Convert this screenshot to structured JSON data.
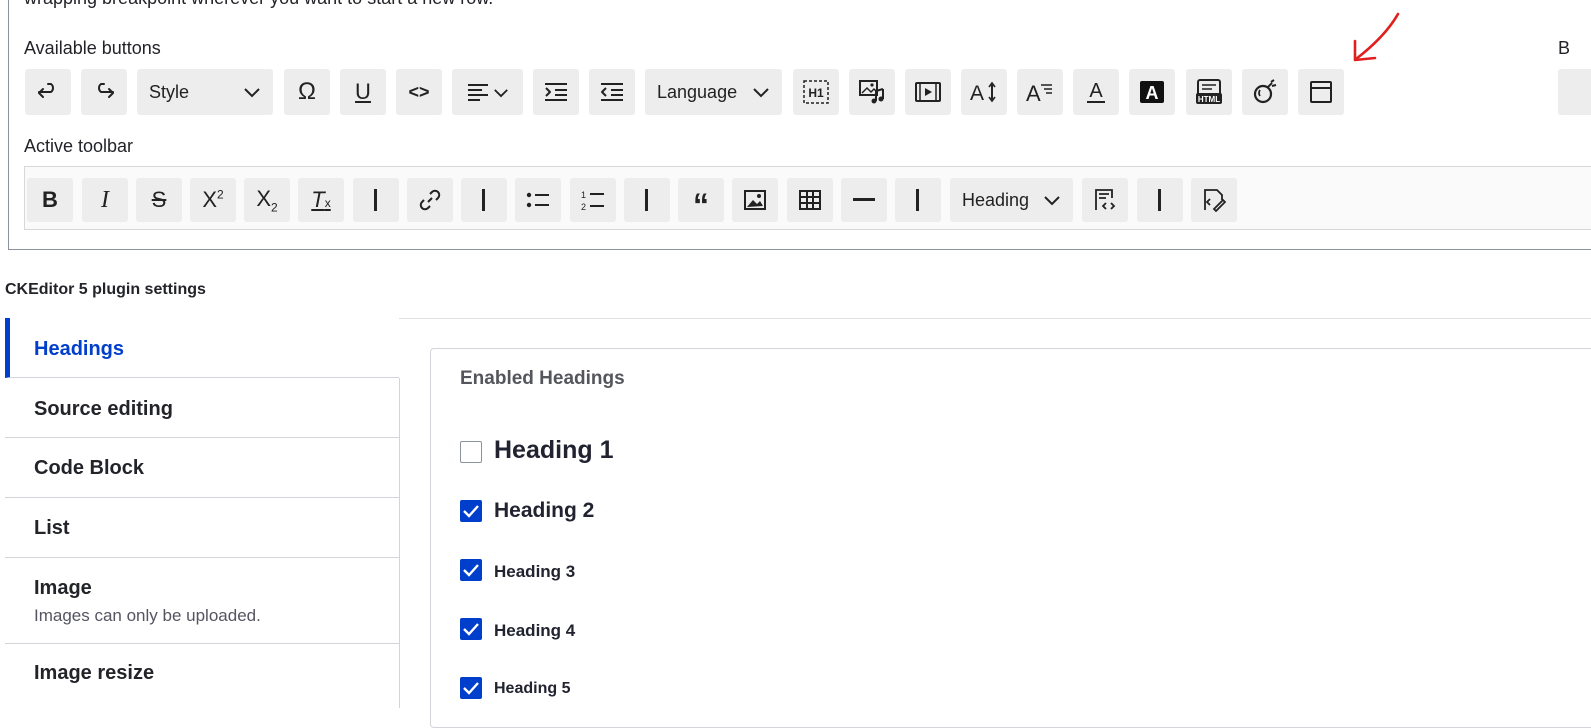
{
  "intro_text": "wrapping breakpoint wherever you want to start a new row.",
  "available": {
    "label": "Available buttons",
    "right_letter": "B",
    "buttons": [
      {
        "name": "undo-icon"
      },
      {
        "name": "redo-icon"
      },
      {
        "name": "style-dropdown",
        "label": "Style"
      },
      {
        "name": "special-characters-icon"
      },
      {
        "name": "underline-icon"
      },
      {
        "name": "code-icon"
      },
      {
        "name": "alignment-dropdown"
      },
      {
        "name": "indent-icon"
      },
      {
        "name": "outdent-icon"
      },
      {
        "name": "language-dropdown",
        "label": "Language"
      },
      {
        "name": "heading-h1-icon"
      },
      {
        "name": "media-library-icon"
      },
      {
        "name": "media-embed-icon"
      },
      {
        "name": "font-size-icon"
      },
      {
        "name": "font-family-icon"
      },
      {
        "name": "font-color-icon"
      },
      {
        "name": "font-background-color-icon"
      },
      {
        "name": "html-embed-icon"
      },
      {
        "name": "bomb-icon"
      },
      {
        "name": "layout-icon"
      }
    ]
  },
  "active": {
    "label": "Active toolbar",
    "heading_dropdown": "Heading"
  },
  "plugin_settings": {
    "title": "CKEditor 5 plugin settings",
    "tabs": [
      {
        "label": "Headings",
        "selected": true
      },
      {
        "label": "Source editing"
      },
      {
        "label": "Code Block"
      },
      {
        "label": "List"
      },
      {
        "label": "Image",
        "description": "Images can only be uploaded."
      },
      {
        "label": "Image resize"
      }
    ],
    "panel": {
      "title": "Enabled Headings",
      "headings": [
        {
          "label": "Heading 1",
          "checked": false
        },
        {
          "label": "Heading 2",
          "checked": true
        },
        {
          "label": "Heading 3",
          "checked": true
        },
        {
          "label": "Heading 4",
          "checked": true
        },
        {
          "label": "Heading 5",
          "checked": true
        }
      ]
    }
  },
  "colors": {
    "accent": "#003ecc",
    "annotation": "#e02020"
  }
}
